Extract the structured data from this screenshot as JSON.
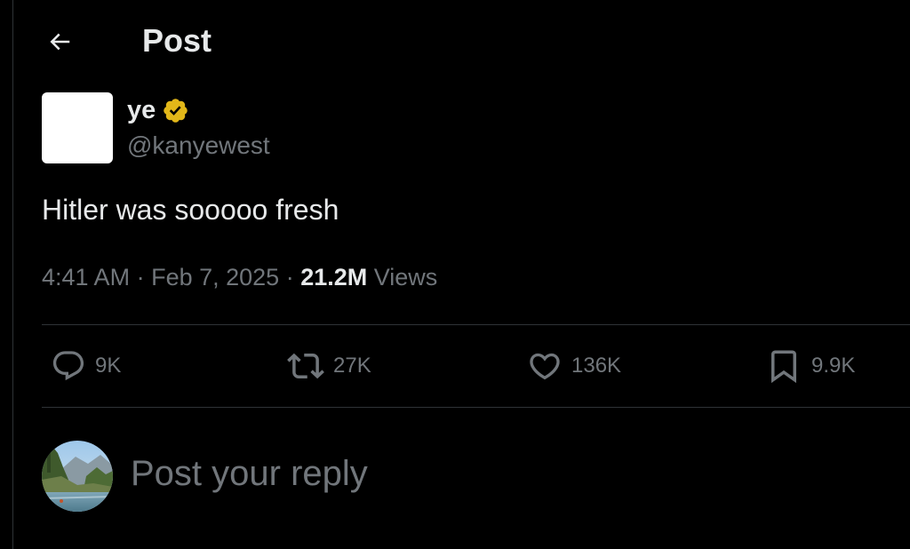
{
  "header": {
    "back_icon": "arrow-left-icon",
    "title": "Post"
  },
  "author": {
    "name": "ye",
    "verified_icon": "verified-badge-icon",
    "verified_color": "#E2B719",
    "handle": "@kanyewest"
  },
  "tweet": {
    "text": "Hitler was sooooo fresh",
    "time": "4:41 AM",
    "separator": "·",
    "date": "Feb 7, 2025",
    "views_count": "21.2M",
    "views_label": "Views"
  },
  "actions": [
    {
      "icon": "reply-icon",
      "count": "9K"
    },
    {
      "icon": "repost-icon",
      "count": "27K"
    },
    {
      "icon": "like-icon",
      "count": "136K"
    },
    {
      "icon": "bookmark-icon",
      "count": "9.9K"
    }
  ],
  "reply": {
    "placeholder": "Post your reply"
  },
  "colors": {
    "background": "#000000",
    "primary_text": "#e7e9ea",
    "secondary_text": "#71767b",
    "divider": "#2f3336"
  }
}
